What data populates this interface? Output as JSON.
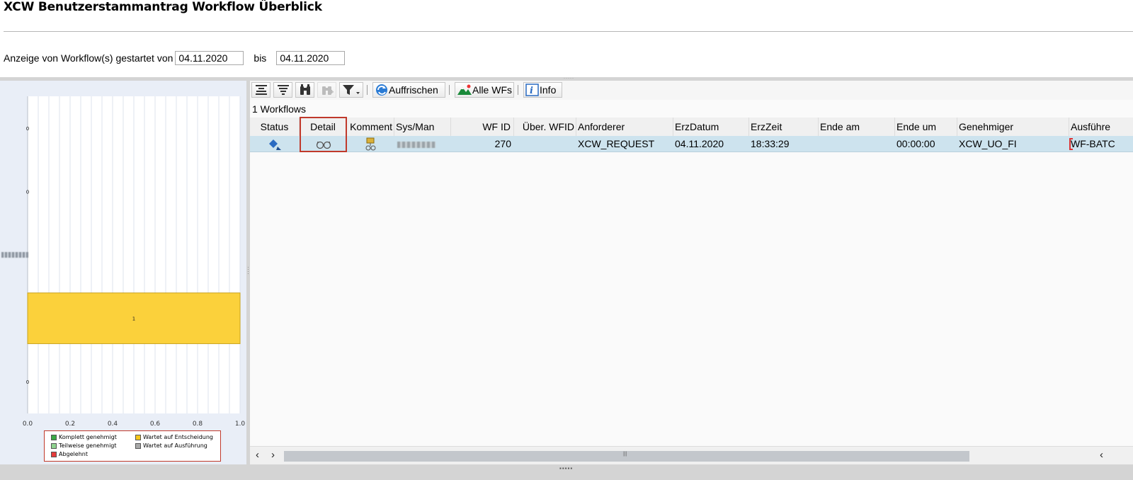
{
  "header": {
    "title": "XCW Benutzerstammantrag Workflow Überblick"
  },
  "filter": {
    "label_prefix": "Anzeige von Workflow(s) gestartet von",
    "from_value": "04.11.2020",
    "to_label": "bis",
    "to_value": "04.11.2020"
  },
  "toolbar": {
    "buttons": [
      {
        "icon": "align-top-icon"
      },
      {
        "icon": "filter-lines-icon"
      },
      {
        "icon": "binoculars-icon"
      },
      {
        "icon": "binoculars-plus-icon",
        "disabled": true
      },
      {
        "icon": "funnel-dropdown-icon"
      }
    ],
    "refresh_label": "Auffrischen",
    "all_wfs_label": "Alle WFs",
    "info_label": "Info"
  },
  "grid": {
    "count_label": "1 Workflows",
    "columns": [
      "Status",
      "Detail",
      "Komment",
      "Sys/Man",
      "WF ID",
      "Über. WFID",
      "Anforderer",
      "ErzDatum",
      "ErzZeit",
      "Ende am",
      "Ende um",
      "Genehmiger",
      "Ausführe"
    ],
    "rows": [
      {
        "status_icon": "workflow-diamond-icon",
        "detail_icon": "glasses-icon",
        "comment_icon": "comment-tag-icon",
        "sys_man": "",
        "wf_id": "270",
        "ueber_wfid": "",
        "anforderer": "XCW_REQUEST",
        "erzdatum": "04.11.2020",
        "erzzeit": "18:33:29",
        "ende_am": "",
        "ende_um": "00:00:00",
        "genehmiger": "XCW_UO_FI",
        "ausfuehrer": "WF-BATC"
      }
    ]
  },
  "chart_data": {
    "type": "bar",
    "orientation": "horizontal",
    "categories": [
      "",
      "",
      "",
      "",
      ""
    ],
    "values": [
      0,
      0,
      0,
      1,
      0
    ],
    "data_labels": [
      "0",
      "0",
      "",
      "1",
      "0"
    ],
    "xlim": [
      0,
      1.0
    ],
    "xticks": [
      "0.0",
      "0.2",
      "0.4",
      "0.6",
      "0.8",
      "1.0"
    ],
    "grid": "vertical",
    "bar_color": "#fbd13b",
    "legend": {
      "placement": "bottom",
      "entries": [
        {
          "label": "Komplett genehmigt",
          "color": "#3aa845"
        },
        {
          "label": "Wartet auf Entscheidung",
          "color": "#f6c619"
        },
        {
          "label": "Teilweise genehmigt",
          "color": "#8fd38f"
        },
        {
          "label": "Wartet auf Ausführung",
          "color": "#a9a9a9"
        },
        {
          "label": "Abgelehnt",
          "color": "#e53a3a"
        }
      ]
    }
  }
}
